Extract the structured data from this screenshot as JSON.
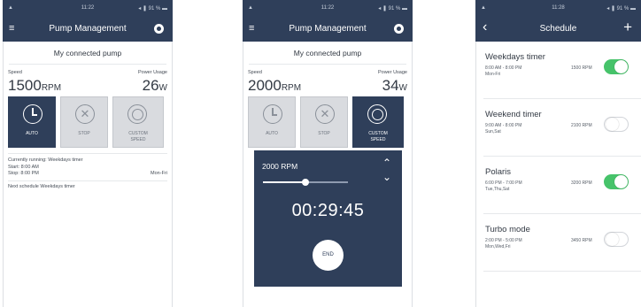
{
  "screens": {
    "pump_main": {
      "status": {
        "time": "11:22",
        "signal": "▲",
        "battery": "◂ ❚ 91 % ▬"
      },
      "header": {
        "title": "Pump Management"
      },
      "pump_name": "My connected pump",
      "speed_label": "Speed",
      "power_label": "Power Usage",
      "speed_value": "1500",
      "speed_unit": "RPM",
      "power_value": "26",
      "power_unit": "W",
      "modes": [
        {
          "label": "AUTO",
          "state": "active",
          "icon": "clock-icon"
        },
        {
          "label": "STOP",
          "state": "inactive",
          "icon": "stop-icon"
        },
        {
          "label": "CUSTOM SPEED",
          "state": "inactive",
          "icon": "gauge-icon"
        }
      ],
      "currently_running": "Currently running: Weekdays timer",
      "start": "Start: 8:00 AM",
      "stop": "Stop: 8:00 PM",
      "days": "Mon-Fri",
      "next_schedule": "Next schedule Weekdays timer"
    },
    "pump_custom": {
      "status": {
        "time": "11:22",
        "signal": "▲",
        "battery": "◂ ❚ 91 % ▬"
      },
      "header": {
        "title": "Pump Management"
      },
      "pump_name": "My connected pump",
      "speed_label": "Speed",
      "power_label": "Power Usage",
      "speed_value": "2000",
      "speed_unit": "RPM",
      "power_value": "34",
      "power_unit": "W",
      "modes": [
        {
          "label": "AUTO",
          "state": "inactive",
          "icon": "clock-icon"
        },
        {
          "label": "STOP",
          "state": "inactive",
          "icon": "stop-icon"
        },
        {
          "label": "CUSTOM SPEED",
          "state": "active",
          "icon": "gauge-icon"
        }
      ],
      "custom": {
        "rpm_label": "2000 RPM",
        "slider_fraction": 0.5,
        "timer": "00:29:45",
        "end_label": "END"
      }
    },
    "schedule": {
      "status": {
        "time": "11:28",
        "signal": "▲",
        "battery": "◂ ❚ 91 % ▬"
      },
      "header": {
        "title": "Schedule"
      },
      "items": [
        {
          "name": "Weekdays timer",
          "time": "8:00 AM - 8:00 PM",
          "days": "Mon-Fri",
          "rpm": "1500 RPM",
          "enabled": true
        },
        {
          "name": "Weekend timer",
          "time": "9:00 AM - 8:00 PM",
          "days": "Sun,Sat",
          "rpm": "2100 RPM",
          "enabled": false
        },
        {
          "name": "Polaris",
          "time": "6:00 PM - 7:00 PM",
          "days": "Tue,Thu,Sat",
          "rpm": "3200 RPM",
          "enabled": true
        },
        {
          "name": "Turbo mode",
          "time": "2:00 PM - 5:00 PM",
          "days": "Mon,Wed,Fri",
          "rpm": "3450 RPM",
          "enabled": false
        }
      ]
    }
  },
  "colors": {
    "navy": "#2f3f5a",
    "toggle_on": "#46c36a",
    "inactive_tile": "#d9dbdf"
  }
}
